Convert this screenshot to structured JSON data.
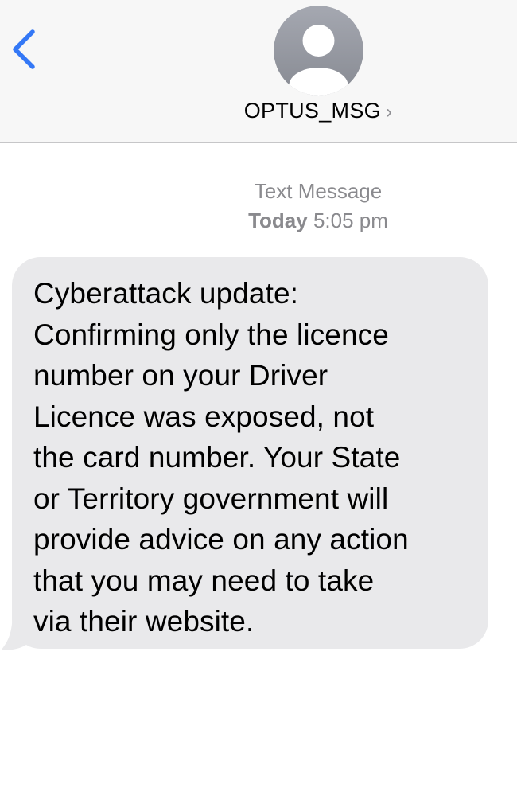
{
  "header": {
    "back_icon": "chevron-left-icon",
    "avatar_icon": "person-avatar-icon",
    "contact_name": "OPTUS_MSG",
    "contact_chevron": "›",
    "accent_color": "#3478f6"
  },
  "conversation": {
    "service_label": "Text Message",
    "day_label": "Today",
    "time_label": "5:05 pm",
    "messages": [
      {
        "direction": "incoming",
        "lines": [
          "Cyberattack update:",
          "Confirming only the licence",
          "number on your Driver",
          "Licence was exposed, not",
          "the card number. Your State",
          "or Territory government will",
          "provide advice on any action",
          "that you may need to take",
          "via their website."
        ]
      }
    ]
  }
}
